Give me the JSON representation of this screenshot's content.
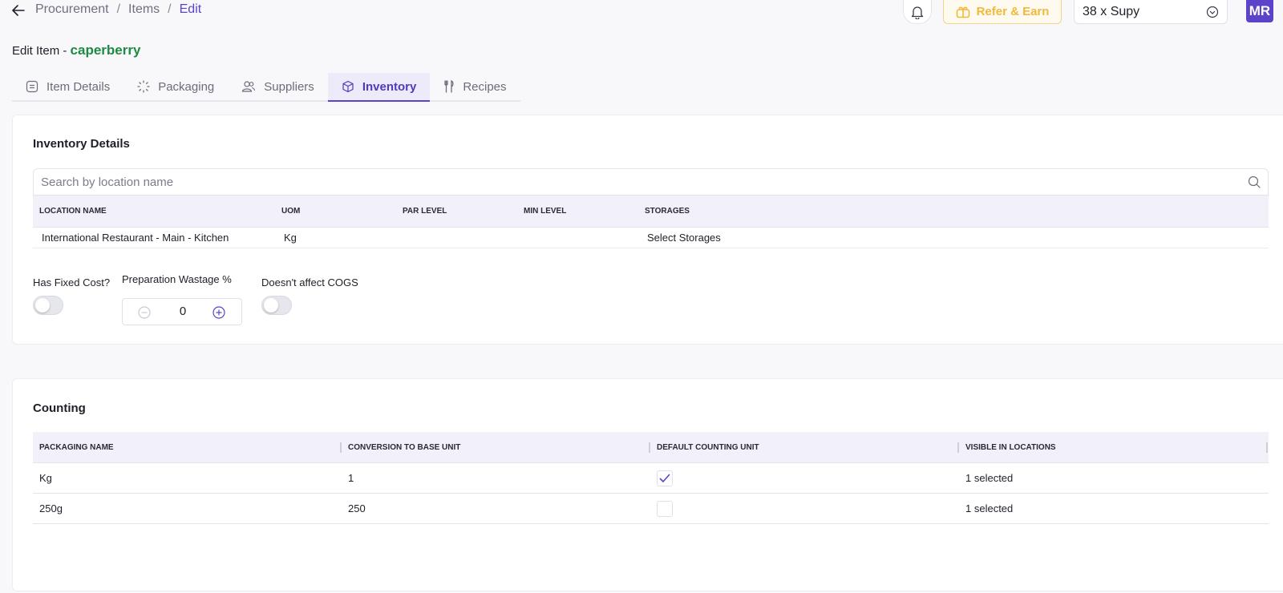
{
  "breadcrumb": {
    "items": [
      "Procurement",
      "Items"
    ],
    "current": "Edit",
    "separator": "/"
  },
  "header": {
    "refer_label": "Refer & Earn",
    "company": "38 x Supy",
    "avatar_initials": "MR"
  },
  "page": {
    "title_prefix": "Edit Item -",
    "item_name": "caperberry"
  },
  "tabs": [
    {
      "label": "Item Details",
      "icon": "list-icon",
      "active": false
    },
    {
      "label": "Packaging",
      "icon": "packaging-icon",
      "active": false
    },
    {
      "label": "Suppliers",
      "icon": "users-icon",
      "active": false
    },
    {
      "label": "Inventory",
      "icon": "box-icon",
      "active": true
    },
    {
      "label": "Recipes",
      "icon": "fork-knife-icon",
      "active": false
    }
  ],
  "inventory": {
    "title": "Inventory Details",
    "search_placeholder": "Search by location name",
    "columns": [
      "LOCATION NAME",
      "UOM",
      "PAR LEVEL",
      "MIN LEVEL",
      "STORAGES"
    ],
    "rows": [
      {
        "location": "International Restaurant - Main - Kitchen",
        "uom": "Kg",
        "par": "",
        "min": "",
        "storages": "Select Storages"
      }
    ],
    "fixed_cost_label": "Has Fixed Cost?",
    "fixed_cost_on": false,
    "wastage_label": "Preparation Wastage %",
    "wastage_value": "0",
    "cogs_label": "Doesn't affect COGS",
    "cogs_on": false
  },
  "counting": {
    "title": "Counting",
    "columns": [
      "PACKAGING NAME",
      "CONVERSION TO BASE UNIT",
      "DEFAULT COUNTING UNIT",
      "VISIBLE IN LOCATIONS"
    ],
    "rows": [
      {
        "name": "Kg",
        "conversion": "1",
        "default": true,
        "visible": "1 selected"
      },
      {
        "name": "250g",
        "conversion": "250",
        "default": false,
        "visible": "1 selected"
      }
    ]
  },
  "colors": {
    "accent": "#5c43c9",
    "item_name": "#1f8a43",
    "refer": "#f0b93a",
    "background": "#f8f8fb"
  }
}
